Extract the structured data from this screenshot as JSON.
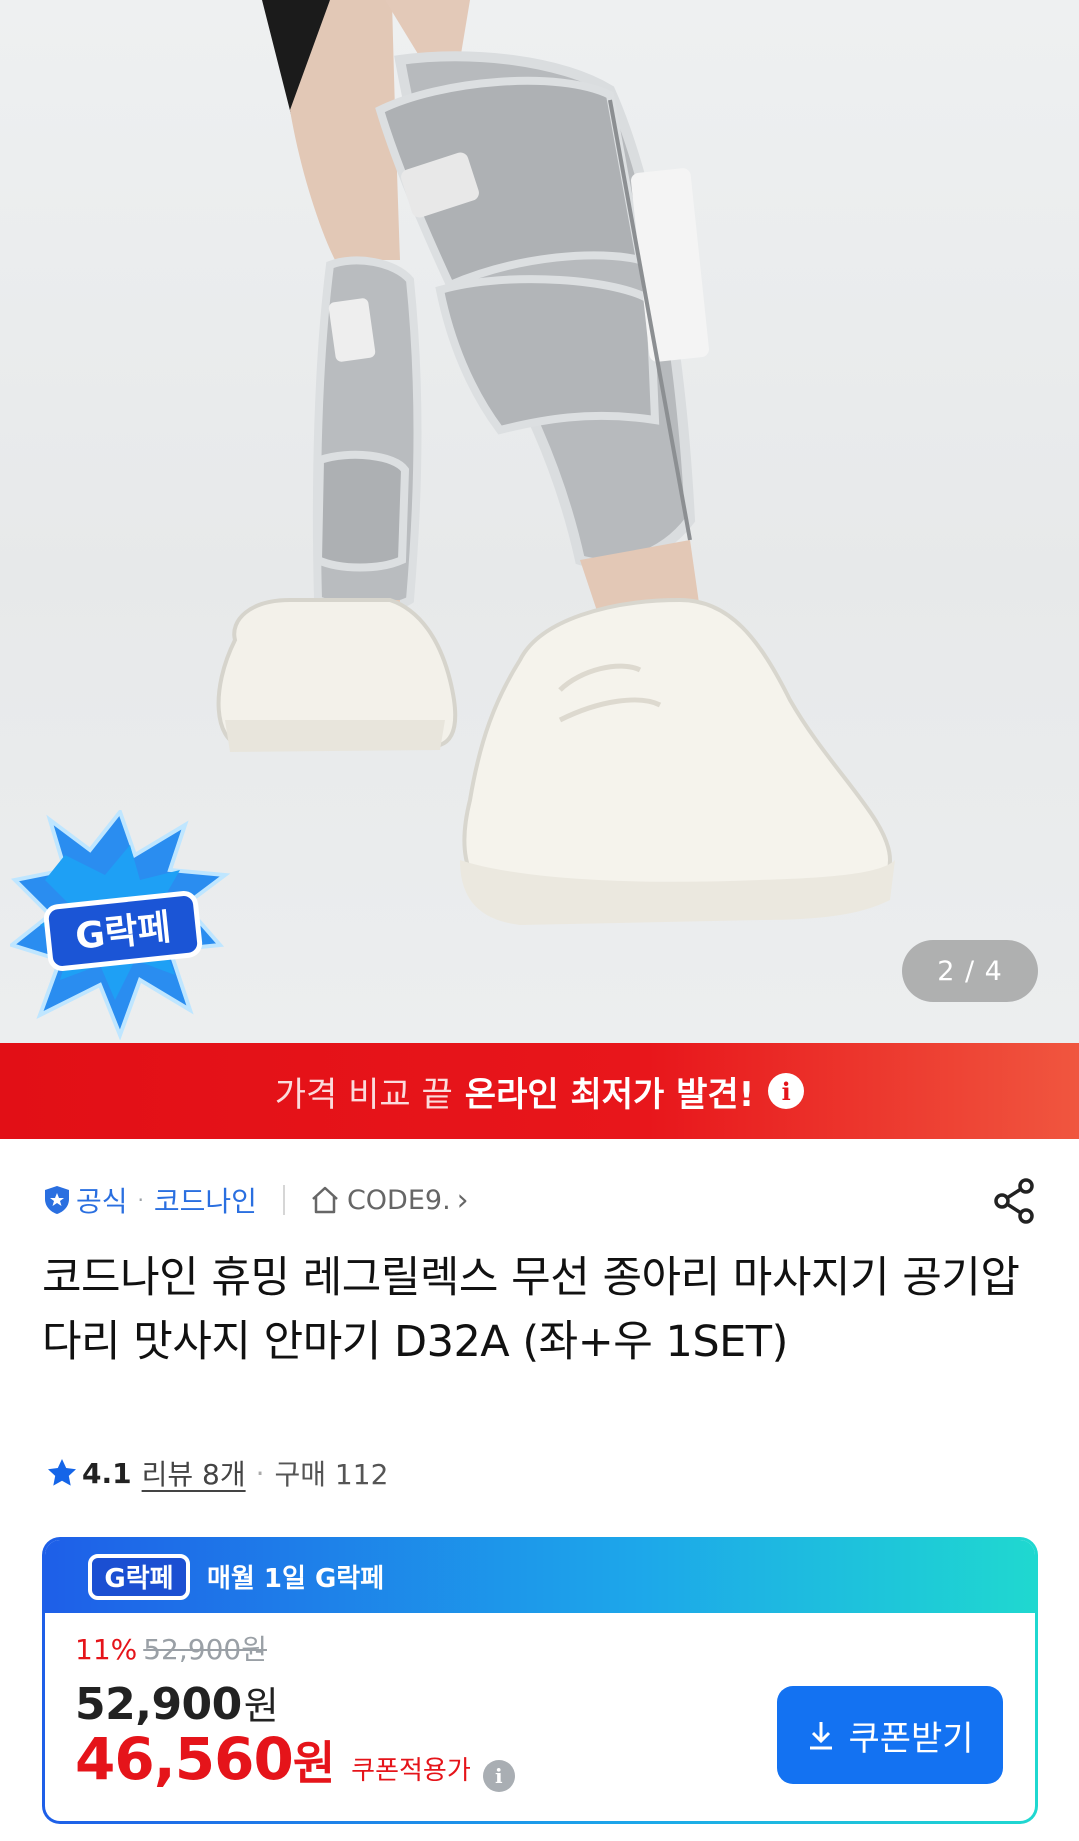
{
  "hero": {
    "image_alt": "calf massager product photo",
    "counter": "2 / 4",
    "badge_text": "G락페"
  },
  "banner": {
    "lead": "가격 비교 끝",
    "highlight": "온라인 최저가 발견!",
    "info_icon": "i"
  },
  "seller": {
    "official": "공식",
    "brand": "코드나인",
    "store": "CODE9.",
    "store_chevron": "›"
  },
  "product": {
    "title": "코드나인 휴밍 레그릴렉스 무선 종아리 마사지기 공기압 다리 맛사지 안마기 D32A (좌+우 1SET)"
  },
  "rating": {
    "score": "4.1",
    "review": "리뷰 8개",
    "purchase": "구매 112"
  },
  "price_card": {
    "header": "매월 1일 G락페",
    "logo_text": "G락페",
    "discount_pct": "11%",
    "original_price": "52,900원",
    "price": "52,900",
    "price_unit": "원",
    "coupon_price": "46,560",
    "coupon_unit": "원",
    "coupon_label": "쿠폰적용가",
    "coupon_button": "쿠폰받기"
  },
  "colors": {
    "accent_red": "#e5141a",
    "accent_blue": "#1372f2",
    "link_blue": "#2a6fe0"
  }
}
